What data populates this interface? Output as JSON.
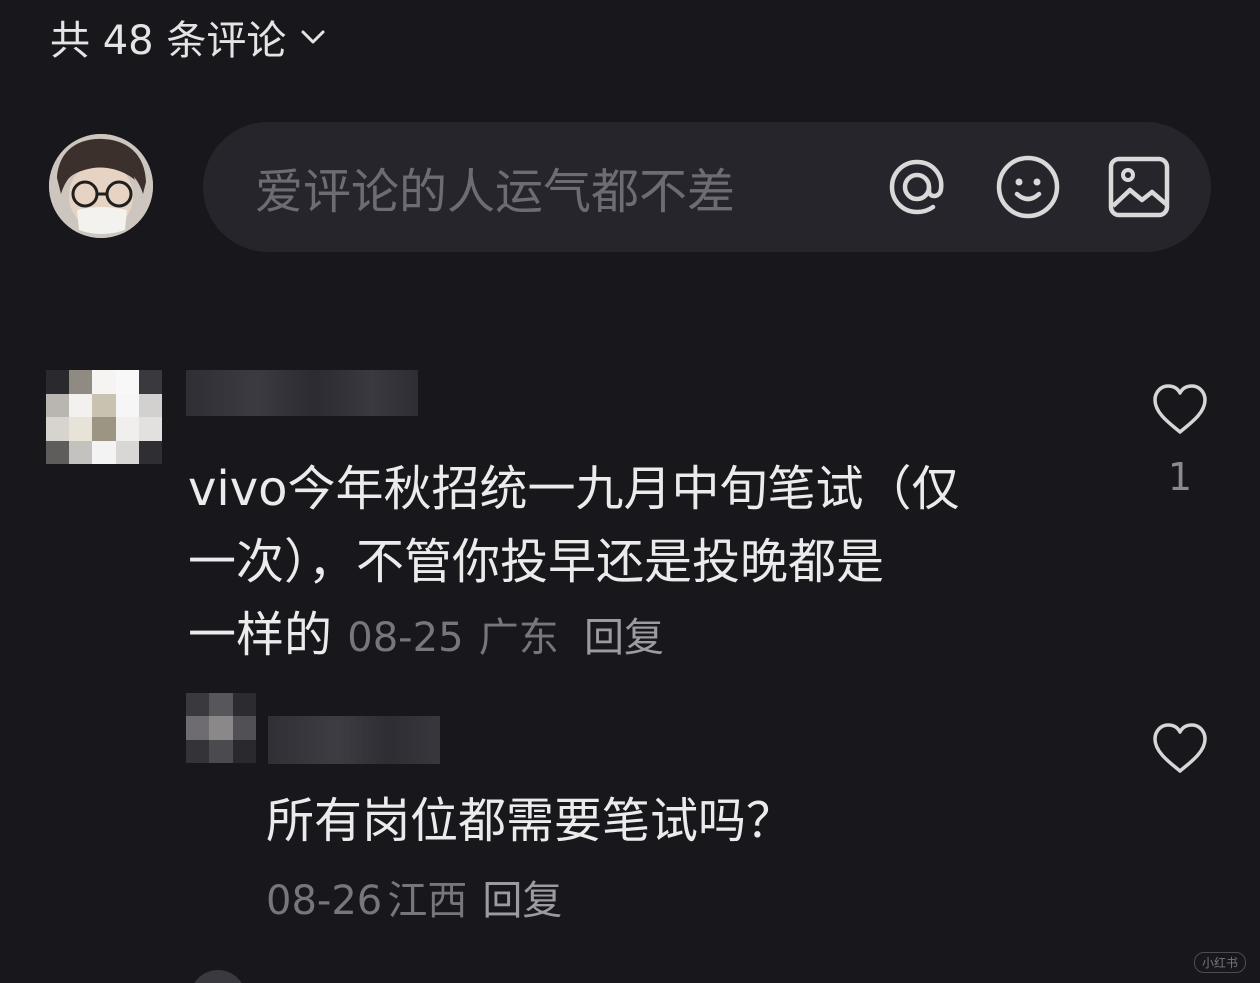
{
  "header": {
    "comment_count_label": "共 48 条评论"
  },
  "composer": {
    "placeholder": "爱评论的人运气都不差"
  },
  "comments": [
    {
      "text_line1": "vivo今年秋招统一九月中旬笔试（仅",
      "text_line2": "一次），不管你投早还是投晚都是",
      "text_line3": "一样的",
      "date": "08-25",
      "location": "广东",
      "reply_label": "回复",
      "like_count": "1"
    }
  ],
  "replies": [
    {
      "text": "所有岗位都需要笔试吗？",
      "date": "08-26",
      "location": "江西",
      "reply_label": "回复"
    }
  ],
  "watermark": "小红书",
  "colors": {
    "background": "#18171c",
    "composer_bg": "#26252b",
    "meta_text": "#77767c"
  }
}
